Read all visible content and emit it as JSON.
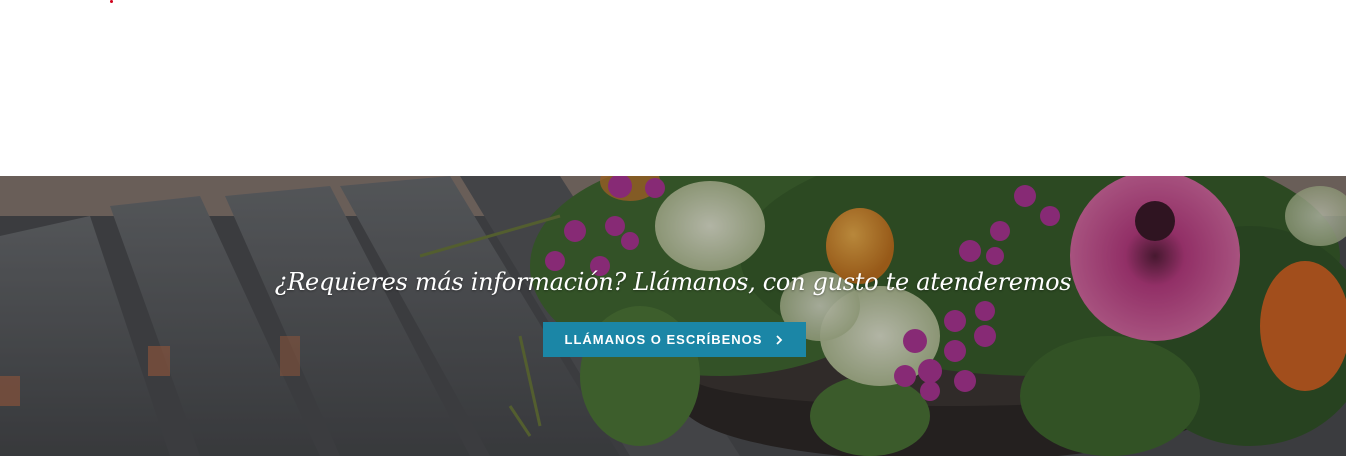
{
  "cta": {
    "heading": "¿Requieres más información? Llámanos, con gusto te atenderemos",
    "button_label": "LLÁMANOS O ESCRÍBENOS",
    "button_icon": "chevron-right-icon"
  },
  "colors": {
    "accent": "#1b86a6",
    "brand_dot": "#d0021b"
  }
}
